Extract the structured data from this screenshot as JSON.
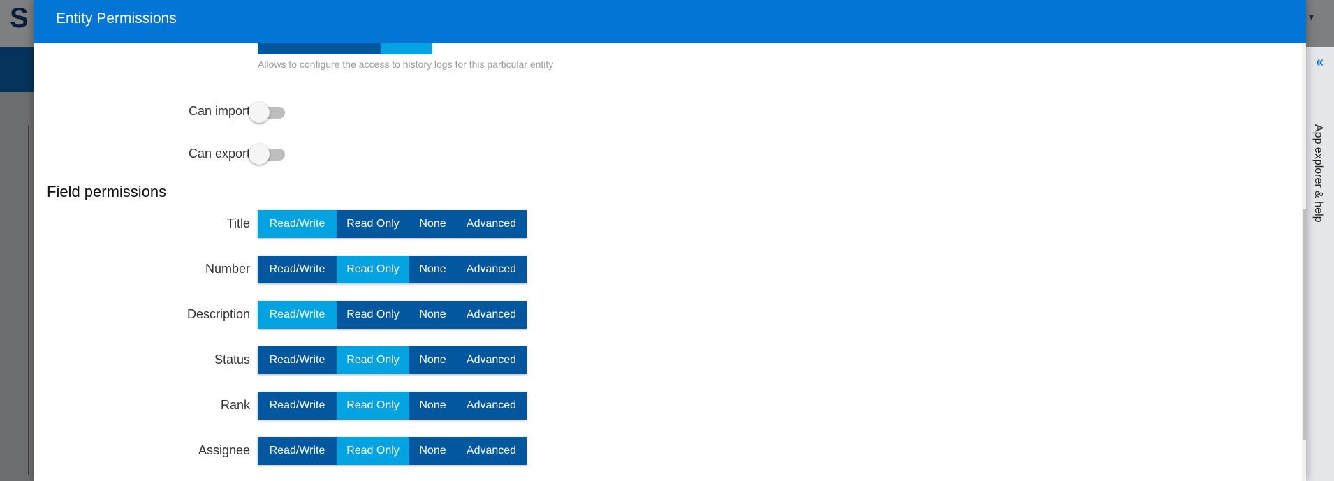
{
  "modal": {
    "title": "Entity Permissions"
  },
  "history": {
    "hint": "Allows to configure the access to history logs for this particular entity"
  },
  "toggles": [
    {
      "label": "Can import",
      "on": false
    },
    {
      "label": "Can export",
      "on": false
    }
  ],
  "field_permissions": {
    "title": "Field permissions",
    "options": [
      "Read/Write",
      "Read Only",
      "None",
      "Advanced"
    ],
    "rows": [
      {
        "label": "Title",
        "selected": "Read/Write"
      },
      {
        "label": "Number",
        "selected": "Read Only"
      },
      {
        "label": "Description",
        "selected": "Read/Write"
      },
      {
        "label": "Status",
        "selected": "Read Only"
      },
      {
        "label": "Rank",
        "selected": "Read Only"
      },
      {
        "label": "Assignee",
        "selected": "Read Only"
      }
    ]
  },
  "side_panel": {
    "label": "App explorer & help",
    "icon": "double-chevron-left-icon"
  },
  "colors": {
    "header": "#0375d6",
    "segment": "#03579f",
    "segment_active": "#03a2e0"
  }
}
